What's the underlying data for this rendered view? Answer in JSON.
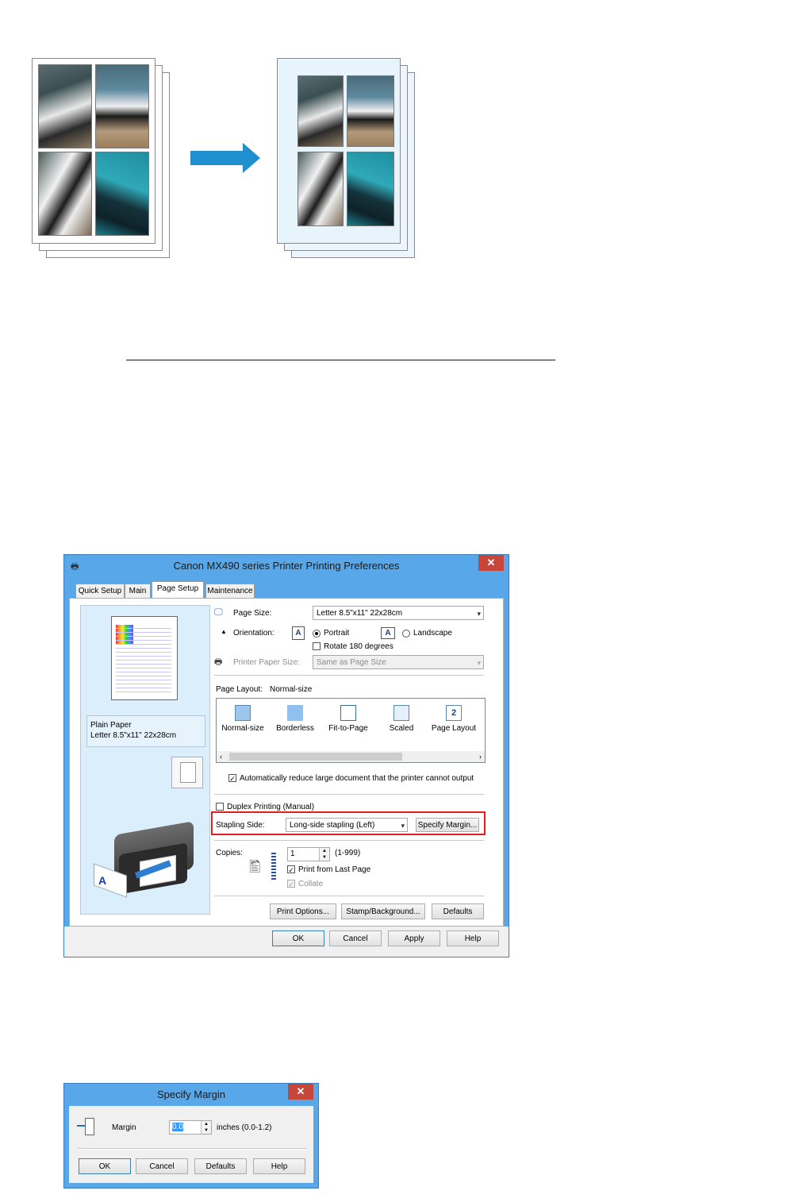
{
  "dialog": {
    "title": "Canon MX490 series Printer Printing Preferences",
    "close_glyph": "✕",
    "tabs": [
      "Quick Setup",
      "Main",
      "Page Setup",
      "Maintenance"
    ],
    "active_tab": "Page Setup",
    "preview": {
      "media_line1": "Plain Paper",
      "media_line2": "Letter 8.5\"x11\" 22x28cm"
    },
    "page_size": {
      "label": "Page Size:",
      "value": "Letter 8.5\"x11\" 22x28cm"
    },
    "orientation": {
      "label": "Orientation:",
      "options": [
        "Portrait",
        "Landscape"
      ],
      "selected": "Portrait",
      "rotate_label": "Rotate 180 degrees",
      "rotate_checked": false
    },
    "printer_paper_size": {
      "label": "Printer Paper Size:",
      "value": "Same as Page Size"
    },
    "page_layout": {
      "label": "Page Layout:",
      "current": "Normal-size",
      "items": [
        "Normal-size",
        "Borderless",
        "Fit-to-Page",
        "Scaled",
        "Page Layout"
      ],
      "auto_reduce_label": "Automatically reduce large document that the printer cannot output",
      "auto_reduce_checked": true
    },
    "duplex": {
      "label": "Duplex Printing (Manual)",
      "checked": false
    },
    "stapling": {
      "label": "Stapling Side:",
      "value": "Long-side stapling (Left)",
      "margin_button": "Specify Margin..."
    },
    "copies": {
      "label": "Copies:",
      "value": "1",
      "range": "(1-999)",
      "print_last_label": "Print from Last Page",
      "print_last_checked": true,
      "collate_label": "Collate",
      "collate_checked": true
    },
    "buttons": {
      "print_options": "Print Options...",
      "stamp": "Stamp/Background...",
      "defaults": "Defaults",
      "ok": "OK",
      "cancel": "Cancel",
      "apply": "Apply",
      "help": "Help"
    },
    "highlight_color": "#e0201c"
  },
  "margin_dialog": {
    "title": "Specify Margin",
    "close_glyph": "✕",
    "margin_label": "Margin",
    "margin_value": "0.0",
    "units": "inches (0.0-1.2)",
    "buttons": {
      "ok": "OK",
      "cancel": "Cancel",
      "defaults": "Defaults",
      "help": "Help"
    }
  },
  "colors": {
    "titlebar": "#58a7e8",
    "close": "#c7463a",
    "arrow": "#1f8fd0",
    "link_underline": "#0000cc"
  }
}
